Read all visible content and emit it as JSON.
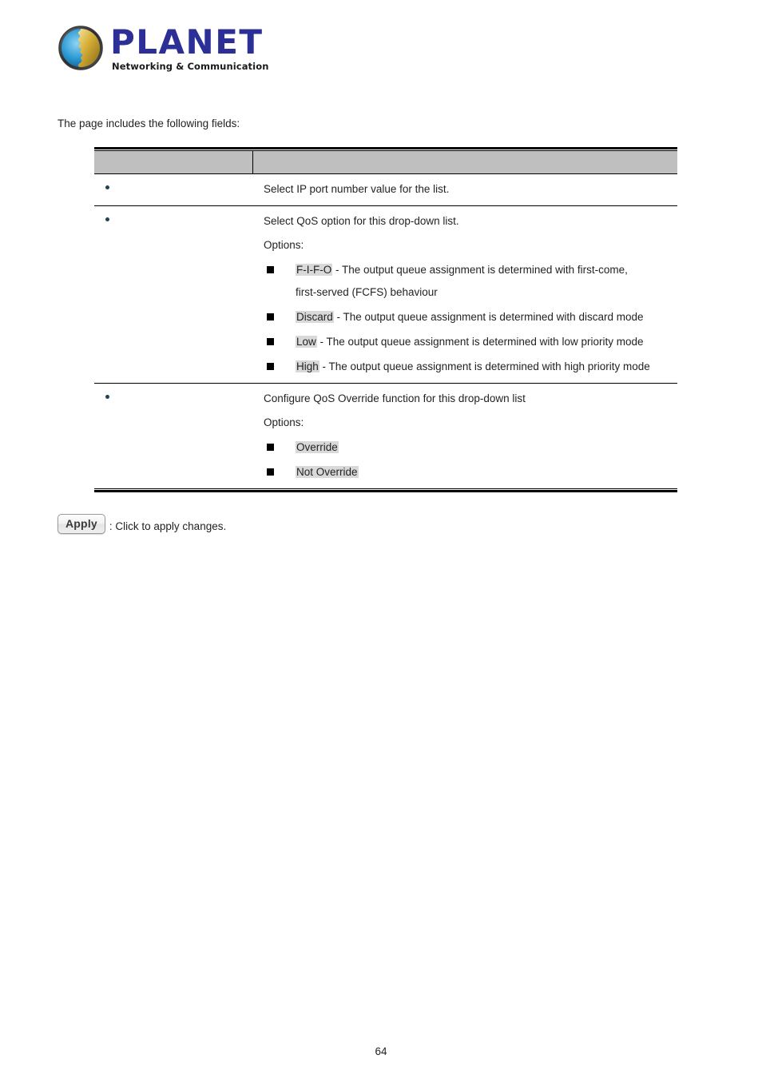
{
  "logo": {
    "wordmark": "PLANET",
    "tagline": "Networking & Communication",
    "brand_color": "#2b2f96",
    "globe_blue": "#2e9bd6",
    "globe_gold": "#c9a227"
  },
  "intro": {
    "text": "The page includes the following fields:"
  },
  "table": {
    "header": {
      "object_column": "",
      "description_column": ""
    },
    "rows": [
      {
        "object": "",
        "description": "Select IP port number value for the list.",
        "options_label": "",
        "options": []
      },
      {
        "object": "",
        "description": "Select QoS option for this drop-down list.",
        "options_label": "Options:",
        "options": [
          {
            "term": "F-I-F-O",
            "rest": " - The output queue assignment is determined with first-come,",
            "continuation": "first-served (FCFS) behaviour"
          },
          {
            "term": "Discard",
            "rest": " - The output queue assignment is determined with discard mode",
            "continuation": ""
          },
          {
            "term": "Low",
            "rest": " - The output queue assignment is determined with low priority mode",
            "continuation": ""
          },
          {
            "term": "High",
            "rest": " - The output queue assignment is determined with high priority mode",
            "continuation": ""
          }
        ]
      },
      {
        "object": "",
        "description": "Configure QoS Override function for this drop-down list",
        "options_label": "Options:",
        "options": [
          {
            "term": "Override",
            "rest": "",
            "continuation": ""
          },
          {
            "term": "Not Override",
            "rest": "",
            "continuation": ""
          }
        ]
      }
    ]
  },
  "apply": {
    "button_label": "Apply",
    "caption": ": Click to apply changes."
  },
  "footer": {
    "page_number": "64"
  }
}
